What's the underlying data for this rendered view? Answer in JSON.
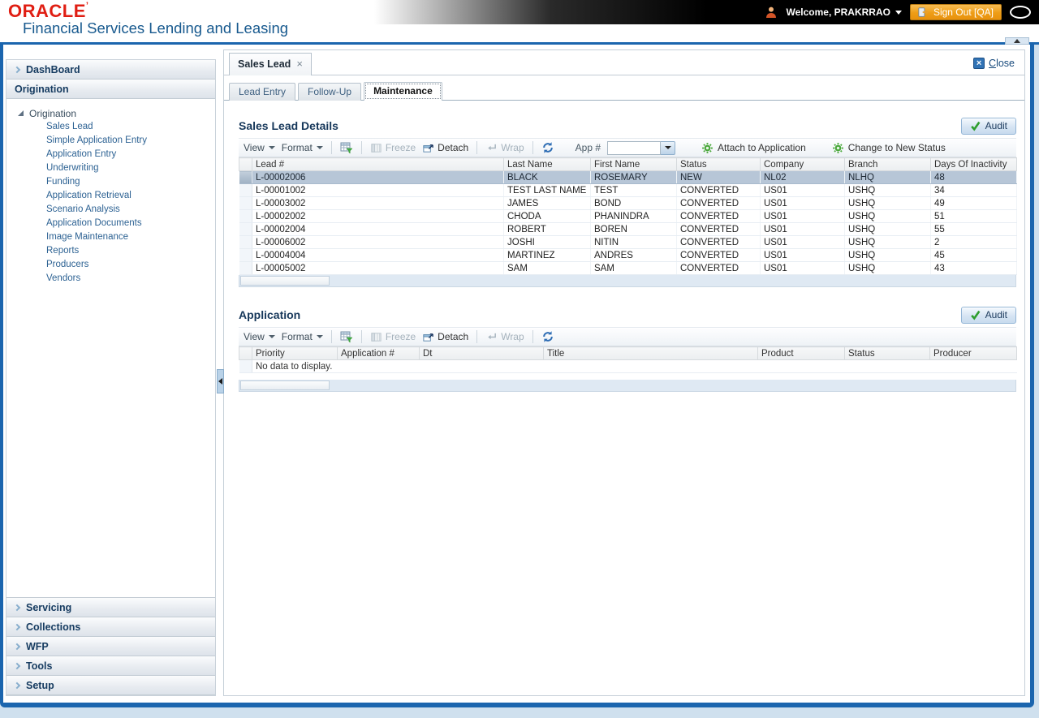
{
  "header": {
    "brand": "ORACLE",
    "brand_mark": "’",
    "product": "Financial Services Lending and Leasing",
    "welcome": "Welcome, PRAKRRAO",
    "sign_out": "Sign Out [QA]"
  },
  "window": {
    "doc_tab": "Sales Lead",
    "doc_tab_close": "×",
    "close_label": "Close"
  },
  "sidebar": {
    "top_sections": [
      {
        "label": "DashBoard",
        "expanded": false
      },
      {
        "label": "Origination",
        "expanded": true
      }
    ],
    "tree_root": "Origination",
    "tree_items": [
      "Sales Lead",
      "Simple Application Entry",
      "Application Entry",
      "Underwriting",
      "Funding",
      "Application Retrieval",
      "Scenario Analysis",
      "Application Documents",
      "Image Maintenance",
      "Reports",
      "Producers",
      "Vendors"
    ],
    "bottom_sections": [
      "Servicing",
      "Collections",
      "WFP",
      "Tools",
      "Setup"
    ]
  },
  "tabs": {
    "items": [
      "Lead Entry",
      "Follow-Up",
      "Maintenance"
    ],
    "active": "Maintenance"
  },
  "toolbar": {
    "view": "View",
    "format": "Format",
    "freeze": "Freeze",
    "detach": "Detach",
    "wrap": "Wrap"
  },
  "sales": {
    "title": "Sales Lead Details",
    "audit": "Audit",
    "app_label": "App #",
    "app_value": "",
    "attach": "Attach to Application",
    "change_status": "Change to New Status",
    "columns": [
      "Lead #",
      "Last Name",
      "First Name",
      "Status",
      "Company",
      "Branch",
      "Days Of Inactivity"
    ],
    "rows": [
      [
        "L-00002006",
        "BLACK",
        "ROSEMARY",
        "NEW",
        "NL02",
        "NLHQ",
        "48"
      ],
      [
        "L-00001002",
        "TEST LAST NAME",
        "TEST",
        "CONVERTED",
        "US01",
        "USHQ",
        "34"
      ],
      [
        "L-00003002",
        "JAMES",
        "BOND",
        "CONVERTED",
        "US01",
        "USHQ",
        "49"
      ],
      [
        "L-00002002",
        "CHODA",
        "PHANINDRA",
        "CONVERTED",
        "US01",
        "USHQ",
        "51"
      ],
      [
        "L-00002004",
        "ROBERT",
        "BOREN",
        "CONVERTED",
        "US01",
        "USHQ",
        "55"
      ],
      [
        "L-00006002",
        "JOSHI",
        "NITIN",
        "CONVERTED",
        "US01",
        "USHQ",
        "2"
      ],
      [
        "L-00004004",
        "MARTINEZ",
        "ANDRES",
        "CONVERTED",
        "US01",
        "USHQ",
        "45"
      ],
      [
        "L-00005002",
        "SAM",
        "SAM",
        "CONVERTED",
        "US01",
        "USHQ",
        "43"
      ]
    ],
    "selected_row": 0
  },
  "application": {
    "title": "Application",
    "audit": "Audit",
    "columns": [
      "Priority",
      "Application #",
      "Dt",
      "Title",
      "Product",
      "Status",
      "Producer"
    ],
    "rows": [],
    "empty_message": "No data to display."
  },
  "colors": {
    "accent_blue": "#1b65ae",
    "oracle_red": "#e01e13",
    "product_blue": "#17598e",
    "selected_row": "#b7c6d7",
    "signout_orange": "#ee9d16",
    "gear_green": "#49a83a",
    "check_green": "#2e9e2e"
  }
}
